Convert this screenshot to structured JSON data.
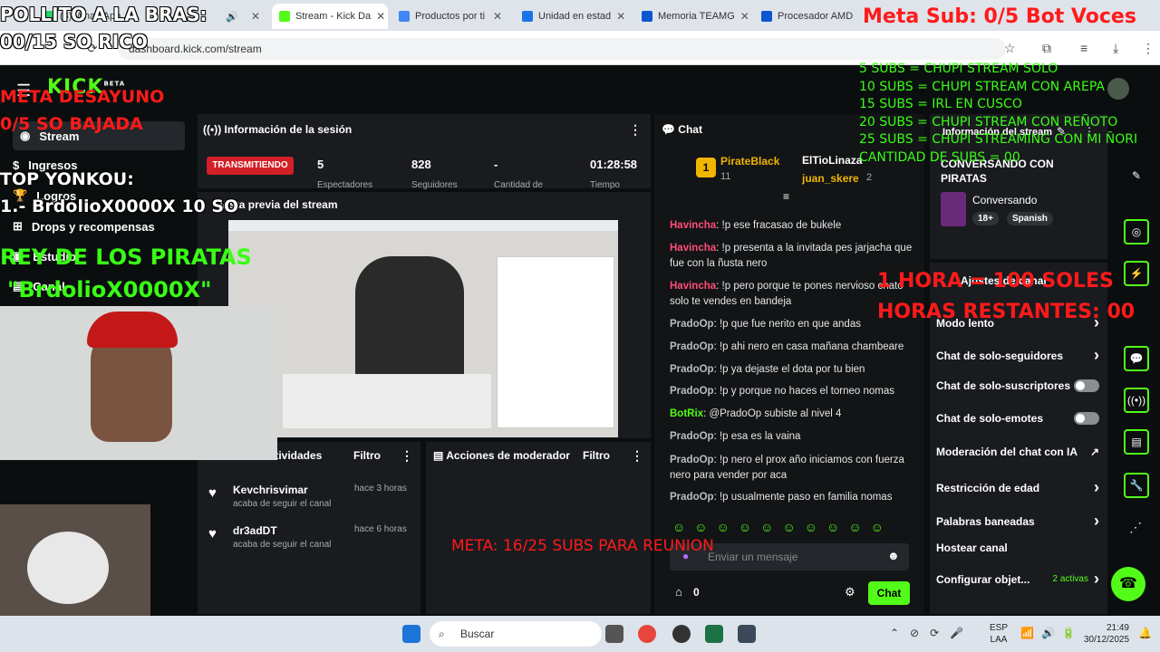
{
  "browser": {
    "tabs": [
      {
        "label": "(3) WhatsApp",
        "color": "#25d366"
      },
      {
        "label": "Stream - Kick Da",
        "color": "#53fc18"
      },
      {
        "label": "Productos por ti",
        "color": "#4285f4"
      },
      {
        "label": "Unidad en estad",
        "color": "#1a73e8"
      },
      {
        "label": "Memoria TEAMG",
        "color": "#0b57d0"
      },
      {
        "label": "Procesador AMD",
        "color": "#0b57d0"
      }
    ],
    "url": "dashboard.kick.com/stream"
  },
  "sidebar": {
    "logo": "KICK",
    "logo_badge": "BETA",
    "items": [
      {
        "label": "Stream"
      },
      {
        "label": "Ingresos"
      },
      {
        "label": "Logros"
      },
      {
        "label": "Drops y recompensas"
      },
      {
        "label": "Estudio"
      },
      {
        "label": "Canal"
      }
    ]
  },
  "session": {
    "title": "Información de la sesión",
    "live_label": "TRANSMITIENDO",
    "stats": [
      {
        "value": "5",
        "label": "Espectadores"
      },
      {
        "value": "828",
        "label": "Seguidores"
      },
      {
        "value": "-",
        "label": "Cantidad de"
      },
      {
        "value": "01:28:58",
        "label": "Tiempo"
      }
    ]
  },
  "preview": {
    "title": "Vista previa del stream"
  },
  "activity": {
    "title": "Actividades",
    "filter": "Filtro",
    "items": [
      {
        "user": "Kevchrisvimar",
        "time": "hace 3 horas",
        "desc": "acaba de seguir el canal"
      },
      {
        "user": "dr3adDT",
        "time": "hace 6 horas",
        "desc": "acaba de seguir el canal"
      }
    ]
  },
  "mod": {
    "title": "Acciones de moderador",
    "filter": "Filtro"
  },
  "chat": {
    "title": "Chat",
    "top": [
      {
        "name": "PirateBlack",
        "count": "11"
      },
      {
        "name": "ElTioLinaza",
        "count": ""
      },
      {
        "name": "juan_skere",
        "count": "2"
      }
    ],
    "messages": [
      {
        "user": "Havincha",
        "text": ": !p ese fracasao de bukele"
      },
      {
        "user": "Havincha",
        "text": ": !p presenta a la invitada pes jarjacha que fue con la ñusta nero"
      },
      {
        "user": "Havincha",
        "text": ": !p pero porque te pones nervioso chato solo te vendes en bandeja"
      },
      {
        "user": "PradoOp",
        "text": ": !p que fue nerito en que andas"
      },
      {
        "user": "PradoOp",
        "text": ": !p ahi nero en casa mañana chambeare"
      },
      {
        "user": "PradoOp",
        "text": ": !p ya dejaste el dota por tu bien"
      },
      {
        "user": "PradoOp",
        "text": ": !p y porque no haces el torneo nomas"
      },
      {
        "user": "BotRix",
        "text": ": @PradoOp subiste al nivel 4"
      },
      {
        "user": "PradoOp",
        "text": ": !p esa es la vaina"
      },
      {
        "user": "PradoOp",
        "text": ": !p nero el prox año iniciamos con fuerza nero para vender por aca"
      },
      {
        "user": "PradoOp",
        "text": ": !p usualmente paso en familia nomas"
      }
    ],
    "placeholder": "Enviar un mensaje",
    "points": "0",
    "send": "Chat"
  },
  "info": {
    "title": "Información del stream",
    "stream_title": "CONVERSANDO CON PIRATAS",
    "category": "Conversando",
    "tags": [
      "18+",
      "Spanish"
    ]
  },
  "settings": {
    "title": "Ajustes de canal",
    "rows": [
      {
        "label": "Modo lento",
        "control": "chevron"
      },
      {
        "label": "Chat de solo-seguidores",
        "control": "chevron"
      },
      {
        "label": "Chat de solo-suscriptores",
        "control": "toggle"
      },
      {
        "label": "Chat de solo-emotes",
        "control": "toggle"
      },
      {
        "label": "Moderación del chat con IA",
        "control": "link"
      },
      {
        "label": "Restricción de edad",
        "control": "chevron"
      },
      {
        "label": "Palabras baneadas",
        "control": "chevron"
      },
      {
        "label": "Hostear canal",
        "control": "none"
      },
      {
        "label": "Configurar objet...",
        "control": "chevron",
        "extra": "2 activas"
      }
    ]
  },
  "overlays": {
    "top_left": "POLLITO A LA BRAS:",
    "top_left2": "00/15 SO RICO",
    "meta_sub": "Meta Sub: 0/5 Bot Voces",
    "desayuno1": "META DESAYUNO",
    "desayuno2": "0/5 SO BAJADA",
    "yonkou1": "TOP YONKOU:",
    "yonkou2": "1.- BrdolioX0000X 10 SO",
    "rey1": "REY DE LOS PIRATAS",
    "rey2": "\"BrdolioX0000X\"",
    "subs": [
      "5 SUBS = CHUPI STREAM SOLO",
      "10 SUBS = CHUPI STREAM CON AREPA",
      "15 SUBS = IRL EN CUSCO",
      "20 SUBS = CHUPI STREAM CON REÑOTO",
      "25 SUBS = CHUPI STREAMING CON MI ÑORI",
      "CANTIDAD DE SUBS = 00"
    ],
    "hora1": "1 HORA = 100 SOLES",
    "hora2": "HORAS RESTANTES: 00",
    "meta_reunion": "META: 16/25 SUBS PARA REUNION"
  },
  "taskbar": {
    "search": "Buscar",
    "lang1": "ESP",
    "lang2": "LAA",
    "time": "21:49",
    "date": "30/12/2025"
  }
}
